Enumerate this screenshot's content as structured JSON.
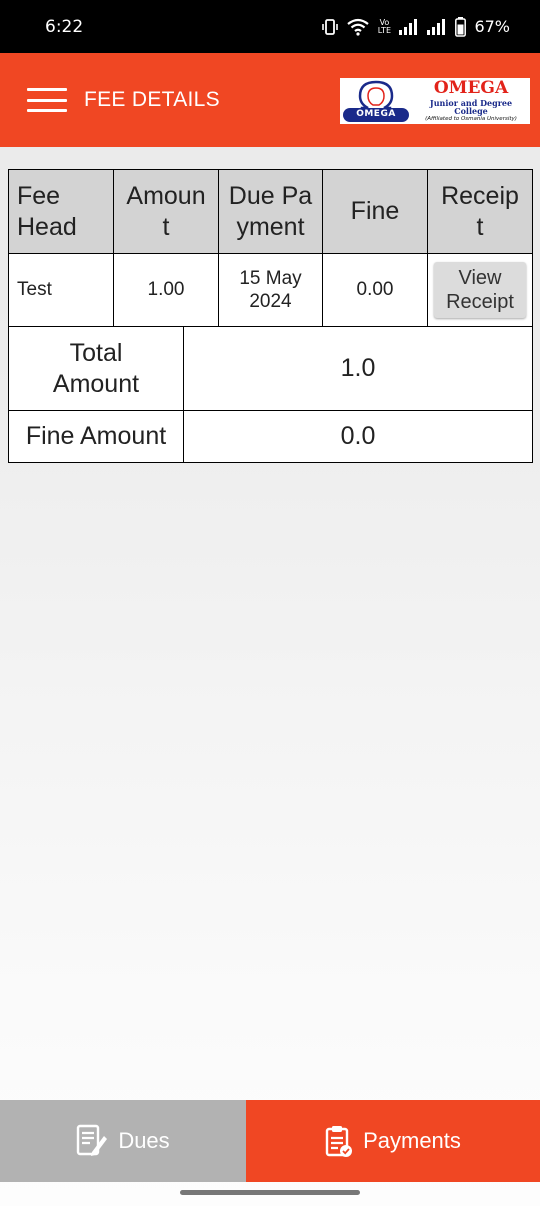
{
  "status_bar": {
    "time": "6:22",
    "network_label": "Vo LTE",
    "battery": "67%"
  },
  "app_bar": {
    "title": "FEE DETAILS",
    "logo": {
      "name": "OMEGA",
      "emblem_text": "OMEGA",
      "subtitle": "Junior and Degree College",
      "affiliation": "(Affiliated to Osmania University)"
    }
  },
  "fee_table": {
    "headers": [
      "Fee Head",
      "Amoun t",
      "Due Pa yment",
      "Fine",
      "Receip t"
    ],
    "header_lines": [
      [
        "Fee",
        "Head"
      ],
      [
        "Amoun",
        "t"
      ],
      [
        "Due Pa",
        "yment"
      ],
      [
        "Fine"
      ],
      [
        "Receip",
        "t"
      ]
    ],
    "rows": [
      {
        "fee_head": "Test",
        "amount": "1.00",
        "due_date_line1": "15 May",
        "due_date_line2": "2024",
        "fine": "0.00",
        "receipt_line1": "View",
        "receipt_line2": "Receipt"
      }
    ]
  },
  "summary": {
    "total_label_line1": "Total",
    "total_label_line2": "Amount",
    "total_value": "1.0",
    "fine_label": "Fine Amount",
    "fine_value": "0.0"
  },
  "bottom_nav": {
    "dues_label": "Dues",
    "payments_label": "Payments"
  },
  "colors": {
    "accent": "#f04723",
    "tab_inactive": "#b2b2b2",
    "header_cell": "#d3d3d3"
  }
}
